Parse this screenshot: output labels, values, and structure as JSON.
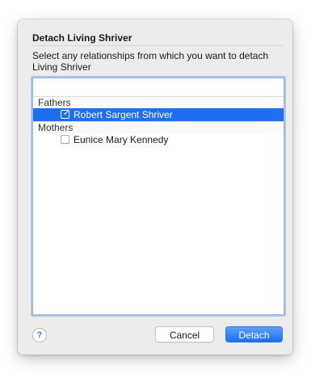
{
  "dialog": {
    "title": "Detach Living Shriver",
    "description": "Select any relationships from which you want to detach Living Shriver",
    "groups": [
      {
        "header": "Fathers",
        "items": [
          {
            "label": "Robert Sargent Shriver",
            "checked": true,
            "selected": true
          }
        ]
      },
      {
        "header": "Mothers",
        "items": [
          {
            "label": "Eunice Mary Kennedy",
            "checked": false,
            "selected": false
          }
        ]
      }
    ],
    "help_label": "?",
    "cancel_label": "Cancel",
    "detach_label": "Detach"
  },
  "colors": {
    "selection": "#1d6ff0",
    "focus_ring": "#a9c6ea",
    "sheet_background": "#ececec"
  }
}
